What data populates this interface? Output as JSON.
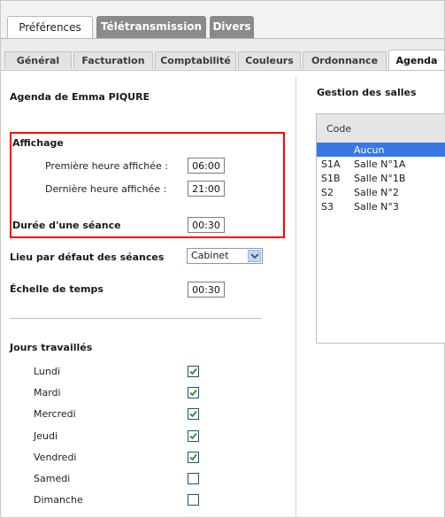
{
  "top_tabs": [
    {
      "label": "Préférences",
      "active": true
    },
    {
      "label": "Télétransmission",
      "active": false
    },
    {
      "label": "Divers",
      "active": false
    }
  ],
  "sub_tabs": [
    {
      "label": "Général",
      "active": false
    },
    {
      "label": "Facturation",
      "active": false
    },
    {
      "label": "Comptabilité",
      "active": false
    },
    {
      "label": "Couleurs",
      "active": false
    },
    {
      "label": "Ordonnance",
      "active": false
    },
    {
      "label": "Agenda",
      "active": true
    }
  ],
  "agenda": {
    "owner": "Agenda de Emma PIQURE",
    "affichage": {
      "title": "Affichage",
      "first_hour_label": "Première heure affichée :",
      "first_hour_value": "06:00",
      "last_hour_label": "Dernière heure affichée :",
      "last_hour_value": "21:00"
    },
    "session_duration_label": "Durée d'une séance",
    "session_duration_value": "00:30",
    "default_place_label": "Lieu par défaut des séances",
    "default_place_value": "Cabinet",
    "time_scale_label": "Échelle de temps",
    "time_scale_value": "00:30",
    "working_days_title": "Jours travaillés",
    "days": [
      {
        "label": "Lundi",
        "checked": true
      },
      {
        "label": "Mardi",
        "checked": true
      },
      {
        "label": "Mercredi",
        "checked": true
      },
      {
        "label": "Jeudi",
        "checked": true
      },
      {
        "label": "Vendredi",
        "checked": true
      },
      {
        "label": "Samedi",
        "checked": false
      },
      {
        "label": "Dimanche",
        "checked": false
      }
    ]
  },
  "rooms": {
    "title": "Gestion des salles",
    "column_code": "Code",
    "rows": [
      {
        "code": "",
        "name": "Aucun",
        "selected": true
      },
      {
        "code": "S1A",
        "name": "Salle N°1A",
        "selected": false
      },
      {
        "code": "S1B",
        "name": "Salle N°1B",
        "selected": false
      },
      {
        "code": "S2",
        "name": "Salle N°2",
        "selected": false
      },
      {
        "code": "S3",
        "name": "Salle N°3",
        "selected": false
      }
    ]
  },
  "colors": {
    "highlight_box": "#ff0000",
    "selected_row": "#3978e4",
    "inactive_tab": "#8a8a8a",
    "checkmark": "#2e8b2e"
  }
}
